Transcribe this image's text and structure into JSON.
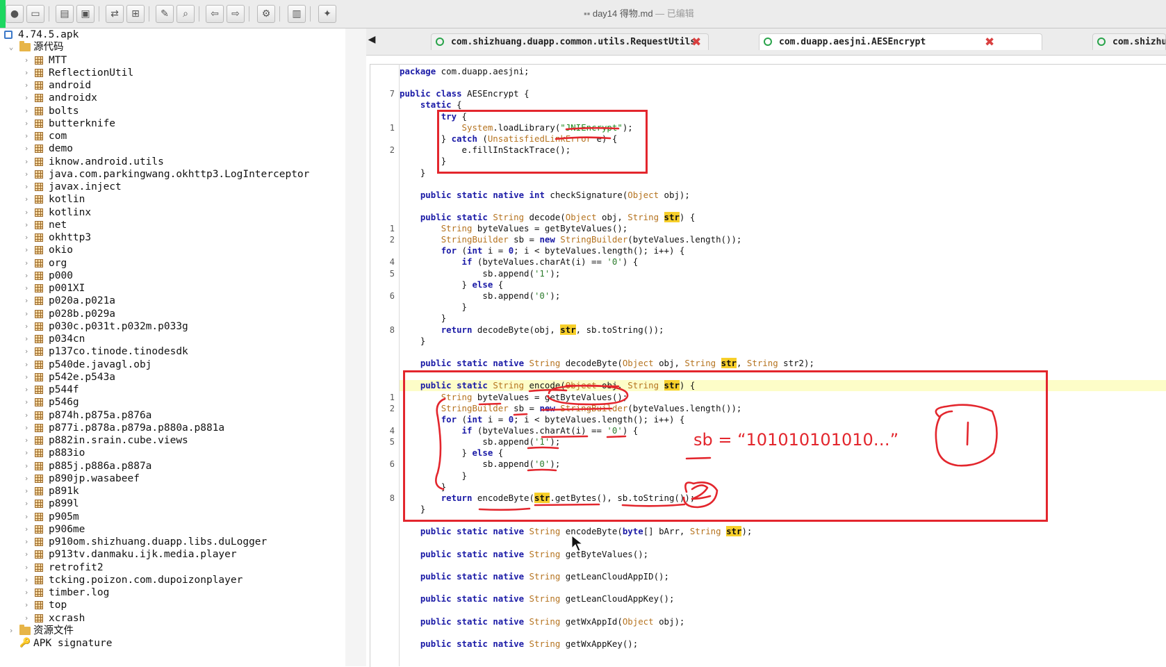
{
  "window": {
    "title": "day14 得物.md",
    "status": "— 已编辑"
  },
  "toolbar": {
    "icons": [
      "open-icon",
      "add-files-icon",
      "save-all-icon",
      "export-icon",
      "sync-icon",
      "flatten-icon",
      "search-text-icon",
      "search-class-icon",
      "back-icon",
      "forward-icon",
      "decompile-icon",
      "log-icon",
      "settings-icon"
    ]
  },
  "tree": {
    "root_label": "4.74.5.apk",
    "source_label": "源代码",
    "packages": [
      "MTT",
      "ReflectionUtil",
      "android",
      "androidx",
      "bolts",
      "butterknife",
      "com",
      "demo",
      "iknow.android.utils",
      "java.com.parkingwang.okhttp3.LogInterceptor",
      "javax.inject",
      "kotlin",
      "kotlinx",
      "net",
      "okhttp3",
      "okio",
      "org",
      "p000",
      "p001XI",
      "p020a.p021a",
      "p028b.p029a",
      "p030c.p031t.p032m.p033g",
      "p034cn",
      "p137co.tinode.tinodesdk",
      "p540de.javagl.obj",
      "p542e.p543a",
      "p544f",
      "p546g",
      "p874h.p875a.p876a",
      "p877i.p878a.p879a.p880a.p881a",
      "p882in.srain.cube.views",
      "p883io",
      "p885j.p886a.p887a",
      "p890jp.wasabeef",
      "p891k",
      "p899l",
      "p905m",
      "p906me",
      "p910om.shizhuang.duapp.libs.duLogger",
      "p913tv.danmaku.ijk.media.player",
      "retrofit2",
      "tcking.poizon.com.dupoizonplayer",
      "timber.log",
      "top",
      "xcrash"
    ],
    "resources_label": "资源文件",
    "signature_label": "APK signature"
  },
  "tabs": [
    {
      "label": "com.shizhuang.duapp.common.utils.RequestUtils",
      "active": false
    },
    {
      "label": "com.duapp.aesjni.AESEncrypt",
      "active": true
    },
    {
      "label": "com.shizhuang",
      "active": false
    }
  ],
  "code": {
    "line_numbers": [
      "7",
      "1",
      "2",
      "1",
      "2",
      "4",
      "5",
      "6",
      "8",
      "1",
      "2",
      "4",
      "5",
      "6",
      "8"
    ],
    "text": {
      "package_kw": "package",
      "package_name": " com.duapp.aesjni;",
      "public": "public",
      "class": "class",
      "static": "static",
      "native": "native",
      "class_decl": " AESEncrypt {",
      "try": "try",
      "catch": "catch",
      "for": "for",
      "if": "if",
      "else": "else",
      "return": "return",
      "new": "new",
      "int": "int",
      "system": "System",
      "load_library": ".loadLibrary(",
      "lib_name": "\"JNIEncrypt\"",
      "load_end": ");",
      "unsatisfied": "UnsatisfiedLinkError",
      "catch_var": " e) {",
      "fill_stack": "e.fillInStackTrace();",
      "check_sig": " checkSignature(",
      "object": "Object",
      "obj_end": " obj);",
      "string": "String",
      "str": "str",
      "obj_comma": " obj, ",
      "decode_name": " decode(",
      "decode_byte_name": " decodeByte(",
      "encode_name": " encode(",
      "encode_byte_name": " encodeByte(",
      "paren_brace": ") {",
      "paren_semi": ");",
      "byte_values_decl": " byteValues = getByteValues();",
      "string_builder": "StringBuilder",
      "sb_decl": " sb = ",
      "sb_new_rest": "(byteValues.length());",
      "for_head_a": " (",
      "for_head_b": " i = ",
      "zero": "0",
      "for_head_c": "; i < byteValues.length(); i++) {",
      "if_head": " (byteValues.charAt(i) == ",
      "char_zero": "'0'",
      "char_one": "'1'",
      "append_a": "sb.append(",
      "close_brace_else": "} ",
      "return_decode": " decodeByte(obj, ",
      "return_decode_end": ", sb.toString());",
      "return_encode": " encodeByte(",
      "return_encode_mid": ".getBytes(), sb.toString());",
      "str2": " str2);",
      "byte_arr": "byte",
      "byte_arr_rest": "[] bArr, ",
      "get_byte_values": " getByteValues();",
      "lean_app_id": " getLeanCloudAppID();",
      "lean_app_key": " getLeanCloudAppKey();",
      "wx_app_id": " getWxAppId(",
      "wx_app_key": " getWxAppKey();",
      "lbrace": " {",
      "rbrace": "}"
    }
  },
  "annotations": {
    "sb_note": "sb = “101010101010…”",
    "circle_one": "1",
    "circle_two": "2"
  },
  "colors": {
    "keyword": "#1a1aa6",
    "type": "#b5731f",
    "string": "#1f8a1f",
    "highlight": "#f7cf2a",
    "annotation": "#e3262d"
  }
}
